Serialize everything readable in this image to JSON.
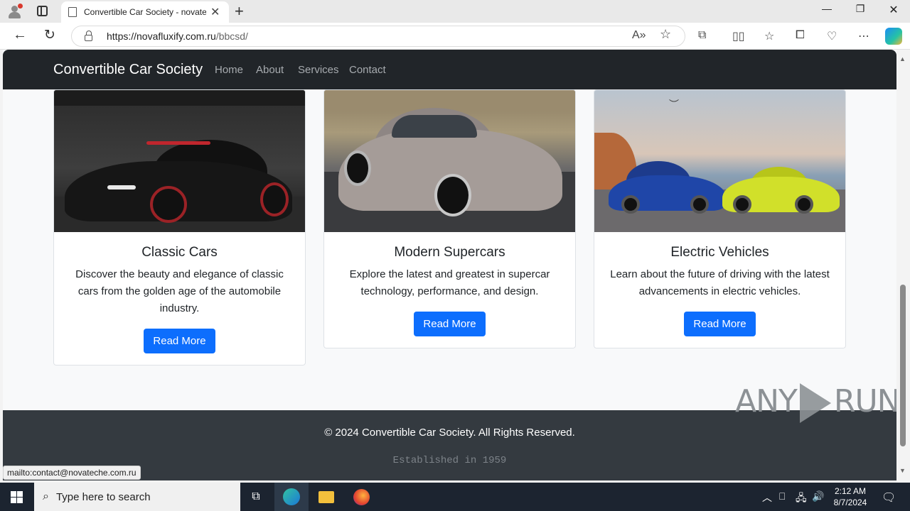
{
  "browser": {
    "tab_title": "Convertible Car Society - novateche",
    "url_host": "https://novafluxify.com.ru",
    "url_path": "/bbcsd/",
    "status_link": "mailto:contact@novateche.com.ru"
  },
  "site": {
    "brand": "Convertible Car Society",
    "nav": [
      "Home",
      "About",
      "Services",
      "Contact"
    ]
  },
  "cards": [
    {
      "title": "Classic Cars",
      "text": "Discover the beauty and elegance of classic cars from the golden age of the automobile industry.",
      "button": "Read More"
    },
    {
      "title": "Modern Supercars",
      "text": "Explore the latest and greatest in supercar technology, performance, and design.",
      "button": "Read More"
    },
    {
      "title": "Electric Vehicles",
      "text": "Learn about the future of driving with the latest advancements in electric vehicles.",
      "button": "Read More"
    }
  ],
  "footer": {
    "copyright": "© 2024 Convertible Car Society. All Rights Reserved.",
    "established": "Established in 1959"
  },
  "watermark": {
    "left": "ANY",
    "right": "RUN"
  },
  "taskbar": {
    "search_placeholder": "Type here to search",
    "time": "2:12 AM",
    "date": "8/7/2024"
  },
  "colors": {
    "primary_button": "#0d6efd",
    "navbar": "#212529",
    "footer": "#343a40"
  }
}
